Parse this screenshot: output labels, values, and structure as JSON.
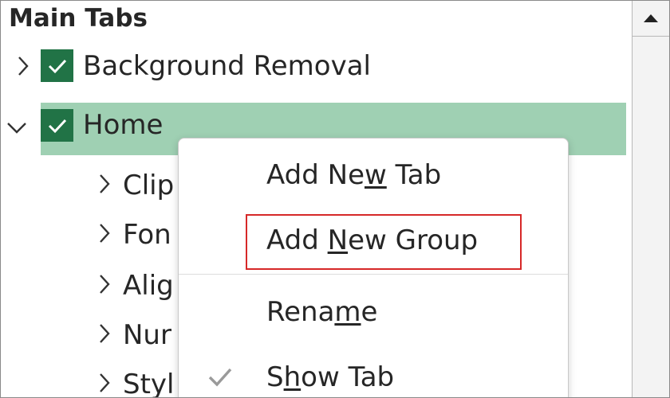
{
  "panel": {
    "title": "Main Tabs"
  },
  "tree": {
    "items": [
      {
        "label": "Background Removal",
        "expanded": false,
        "checked": true
      },
      {
        "label": "Home",
        "expanded": true,
        "checked": true,
        "selected": true
      }
    ],
    "children": [
      {
        "label": "Clip"
      },
      {
        "label": "Fon"
      },
      {
        "label": "Alig"
      },
      {
        "label": "Nur"
      },
      {
        "label": "Styl"
      }
    ]
  },
  "context_menu": {
    "items": [
      {
        "pre": "Add Ne",
        "accel": "w",
        "post": " Tab"
      },
      {
        "pre": "Add ",
        "accel": "N",
        "post": "ew Group",
        "highlighted": true
      },
      {
        "pre": "Rena",
        "accel": "m",
        "post": "e"
      },
      {
        "pre": "S",
        "accel": "h",
        "post": "ow Tab",
        "checked": true
      }
    ]
  },
  "colors": {
    "checkbox": "#217346",
    "selected_row": "#9fd0b3",
    "highlight_box": "#d62828"
  },
  "icons": {
    "expand": "chevron-right-icon",
    "collapse": "chevron-down-icon",
    "check": "checkmark-icon",
    "scroll_up": "triangle-up-icon"
  }
}
